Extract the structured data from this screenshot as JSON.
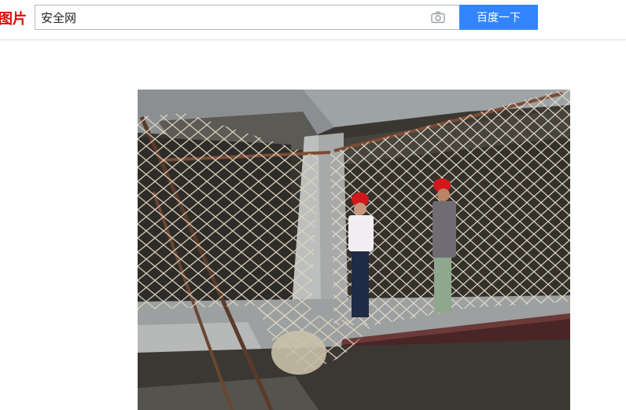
{
  "header": {
    "logo_text": "图片",
    "logo_color": "#e10601"
  },
  "search": {
    "query": "安全网",
    "button_label": "百度一下",
    "button_color": "#3385ff",
    "camera_icon": "camera-icon"
  },
  "result": {
    "image_subject": "safety-net-photo"
  }
}
